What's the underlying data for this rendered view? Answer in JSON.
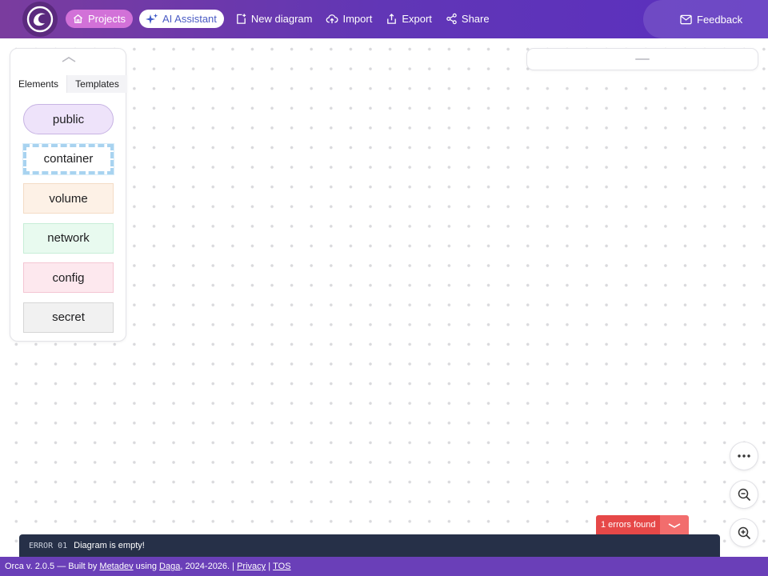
{
  "header": {
    "logo_icon": "orca-logo-icon",
    "nav": [
      {
        "label": "Projects",
        "icon": "home-icon"
      },
      {
        "label": "AI Assistant",
        "icon": "sparkles-icon"
      },
      {
        "label": "New diagram",
        "icon": "new-file-icon"
      },
      {
        "label": "Import",
        "icon": "cloud-upload-icon"
      },
      {
        "label": "Export",
        "icon": "export-icon"
      },
      {
        "label": "Share",
        "icon": "share-icon"
      }
    ],
    "feedback": {
      "label": "Feedback",
      "icon": "mail-icon"
    }
  },
  "panel": {
    "tabs": [
      "Elements",
      "Templates"
    ],
    "elements": [
      {
        "label": "public",
        "color": "#eee3fa"
      },
      {
        "label": "container",
        "color": "#a8d3f0"
      },
      {
        "label": "volume",
        "color": "#fdf1e6"
      },
      {
        "label": "network",
        "color": "#e8faef"
      },
      {
        "label": "config",
        "color": "#fde8ee"
      },
      {
        "label": "secret",
        "color": "#f1f1f1"
      }
    ]
  },
  "controls": {
    "more_icon": "more-horizontal-icon",
    "zoom_out_icon": "zoom-out-icon",
    "zoom_in_icon": "zoom-in-icon"
  },
  "errors": {
    "count_label": "1 errors found",
    "toggle_icon": "chevron-down-icon",
    "items": [
      {
        "code": "ERROR 01",
        "message": "Diagram is empty!"
      }
    ]
  },
  "footer": {
    "prefix": "Orca v. 2.0.5 — Built by ",
    "author": "Metadev",
    "using": " using ",
    "lib": "Daga",
    "years": ", 2024-2026. | ",
    "privacy": "Privacy",
    "sep": " | ",
    "tos": "TOS"
  },
  "colors": {
    "accent": "#6136b6",
    "error": "#e64848",
    "console_bg": "#263048"
  }
}
